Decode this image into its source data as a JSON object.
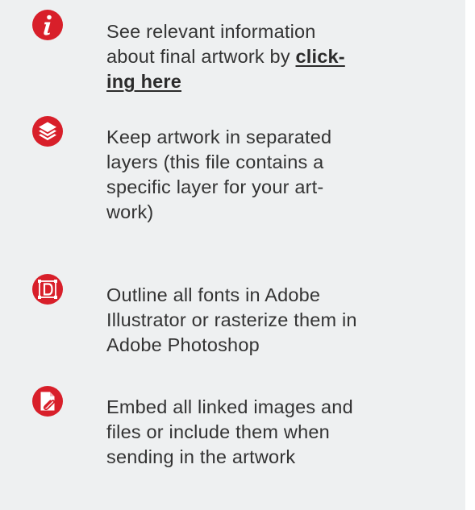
{
  "accent_color": "#d81f2a",
  "items": [
    {
      "icon": "info-icon",
      "lines": [
        "See relevant information",
        "about final artwork by "
      ],
      "link_parts": [
        "click-",
        "ing here"
      ]
    },
    {
      "icon": "layers-icon",
      "lines": [
        "Keep artwork in separated",
        "layers (this file contains a",
        "specific layer for your art-",
        "work)"
      ]
    },
    {
      "icon": "outline-font-icon",
      "lines": [
        "Outline all fonts in Adobe",
        "Illustrator or rasterize them in",
        "Adobe Photoshop"
      ]
    },
    {
      "icon": "embed-file-icon",
      "lines": [
        "Embed all linked images and",
        "files or include them when",
        "sending in the artwork"
      ]
    }
  ]
}
